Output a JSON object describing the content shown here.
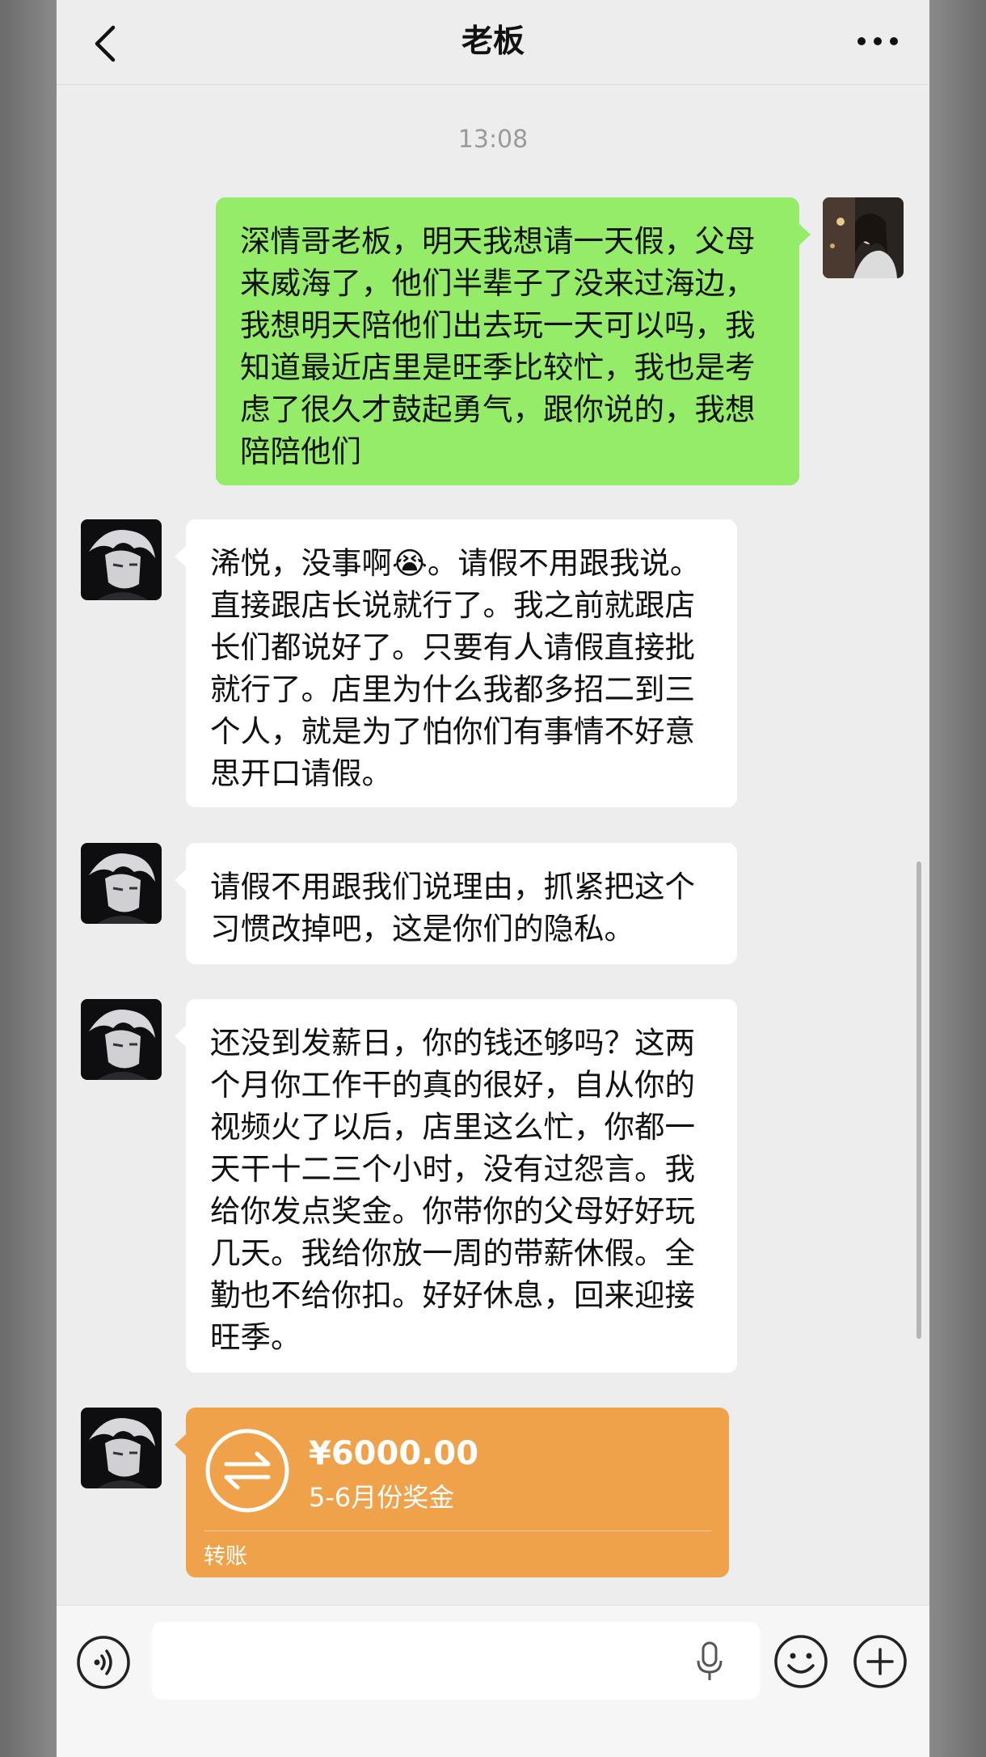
{
  "nav": {
    "title": "老板"
  },
  "timestamp": "13:08",
  "messages": [
    {
      "from": "me",
      "text": "深情哥老板，明天我想请一天假，父母来威海了，他们半辈子了没来过海边，我想明天陪他们出去玩一天可以吗，我知道最近店里是旺季比较忙，我也是考虑了很久才鼓起勇气，跟你说的，我想陪陪他们"
    },
    {
      "from": "them",
      "text": "浠悦，没事啊😭。请假不用跟我说。直接跟店长说就行了。我之前就跟店长们都说好了。只要有人请假直接批就行了。店里为什么我都多招二到三个人，就是为了怕你们有事情不好意思开口请假。"
    },
    {
      "from": "them",
      "text": "请假不用跟我们说理由，抓紧把这个习惯改掉吧，这是你们的隐私。"
    },
    {
      "from": "them",
      "text": "还没到发薪日，你的钱还够吗？这两个月你工作干的真的很好，自从你的视频火了以后，店里这么忙，你都一天干十二三个小时，没有过怨言。我给你发点奖金。你带你的父母好好玩几天。我给你放一周的带薪休假。全勤也不给你扣。好好休息，回来迎接旺季。"
    }
  ],
  "transfer": {
    "amount": "¥6000.00",
    "note": "5-6月份奖金",
    "label": "转账"
  },
  "icons": {
    "back": "chevron-left-icon",
    "more": "more-dots-icon",
    "voice": "voice-icon",
    "mic": "mic-icon",
    "emoji": "emoji-icon",
    "plus": "plus-icon",
    "transfer": "transfer-icon"
  },
  "colors": {
    "my_bubble": "#95ec69",
    "their_bubble": "#ffffff",
    "transfer_card": "#f0a24b",
    "background": "#ededed"
  }
}
